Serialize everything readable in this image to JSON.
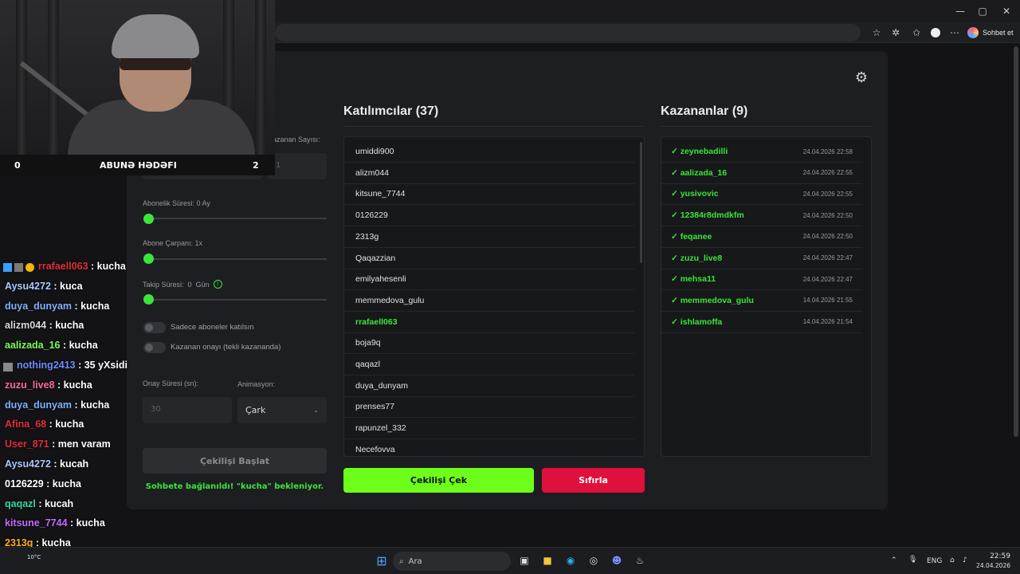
{
  "browser": {
    "window_controls": [
      "—",
      "▢",
      "✕"
    ],
    "assistant_label": "Sohbet et"
  },
  "webcam": {
    "goal": {
      "left": "0",
      "title": "ABUNƏ HƏDƏFI",
      "right": "2"
    }
  },
  "settings": {
    "winner_count_label": "azanan Sayısı:",
    "winner_count_value": "1",
    "sub_duration_label": "Abonelik Süresi: 0 Ay",
    "sub_multiplier_label": "Abone Çarpanı: 1x",
    "follow_label": "Takip Süresi:",
    "follow_value": "0",
    "follow_unit": "Gün",
    "follow_info": "!",
    "toggle_subs_only": "Sadece aboneler katılsın",
    "toggle_winner_confirm": "Kazanan onayı (tekli kazananda)",
    "confirm_time_label": "Onay Süresi (sn):",
    "confirm_time_value": "30",
    "animation_label": "Animasyon:",
    "animation_value": "Çark",
    "start_button": "Çekilişi Başlat",
    "status_text": "Sohbete bağlanıldı! \"kucha\" bekleniyor."
  },
  "participants": {
    "title": "Katılımcılar (37)",
    "items": [
      "umiddi900",
      "alizm044",
      "kitsune_7744",
      "0126229",
      "2313g",
      "Qaqazzian",
      "emilyahesenli",
      "memmedova_gulu",
      "rrafaell063",
      "boja9q",
      "qaqazl",
      "duya_dunyam",
      "prenses77",
      "rapunzel_332",
      "Necefovva"
    ],
    "highlighted_index": 8
  },
  "winners": {
    "title": "Kazananlar (9)",
    "items": [
      {
        "name": "✓ zeynebadilli",
        "date": "24.04.2026 22:58"
      },
      {
        "name": "✓ aalizada_16",
        "date": "24.04.2026 22:55"
      },
      {
        "name": "✓ yusivovic",
        "date": "24.04.2026 22:55"
      },
      {
        "name": "✓ 12384r8dmdkfm",
        "date": "24.04.2026 22:50"
      },
      {
        "name": "✓ feqanee",
        "date": "24.04.2026 22:50"
      },
      {
        "name": "✓ zuzu_live8",
        "date": "24.04.2026 22:47"
      },
      {
        "name": "✓ mehsa11",
        "date": "24.04.2026 22:47"
      },
      {
        "name": "✓ memmedova_gulu",
        "date": "14.04.2026 21:55"
      },
      {
        "name": "✓ ishlamoffa",
        "date": "14.04.2026 21:54"
      }
    ]
  },
  "actions": {
    "draw_button": "Çekilişi Çek",
    "reset_button": "Sıfırla"
  },
  "chat": [
    {
      "user": "rrafaell063",
      "color": "#e0303c",
      "text": ": kucha"
    },
    {
      "user": "Aysu4272",
      "color": "#a8c8ff",
      "text": ": kuca"
    },
    {
      "user": "duya_dunyam",
      "color": "#7fb2ff",
      "text": ": kucha"
    },
    {
      "user": "alizm044",
      "color": "#d8d8d8",
      "text": ": kucha"
    },
    {
      "user": "aalizada_16",
      "color": "#7dff5a",
      "text": ": kucha"
    },
    {
      "user": "nothing2413",
      "color": "#6e8cff",
      "text": ": 35 yXsidi"
    },
    {
      "user": "zuzu_live8",
      "color": "#ff6a9a",
      "text": ": kucha"
    },
    {
      "user": "duya_dunyam",
      "color": "#7fb2ff",
      "text": ": kucha"
    },
    {
      "user": "Afina_68",
      "color": "#e0303c",
      "text": ": kucha"
    },
    {
      "user": "User_871",
      "color": "#e0303c",
      "text": ": men varam"
    },
    {
      "user": "Aysu4272",
      "color": "#a8c8ff",
      "text": ": kucah"
    },
    {
      "user": "0126229",
      "color": "#ffffff",
      "text": ": kucha"
    },
    {
      "user": "qaqazl",
      "color": "#39d9a0",
      "text": ": kucah"
    },
    {
      "user": "kitsune_7744",
      "color": "#c06cff",
      "text": ": kucha"
    },
    {
      "user": "2313g",
      "color": "#ffb020",
      "text": ": kucha"
    },
    {
      "user": "duya_dunyam",
      "color": "#7fb2ff",
      "text": ": kucha"
    }
  ],
  "taskbar": {
    "weather": "10°C",
    "search_placeholder": "Ara",
    "lang": "ENG",
    "time": "22:59",
    "date": "24.04.2026"
  }
}
